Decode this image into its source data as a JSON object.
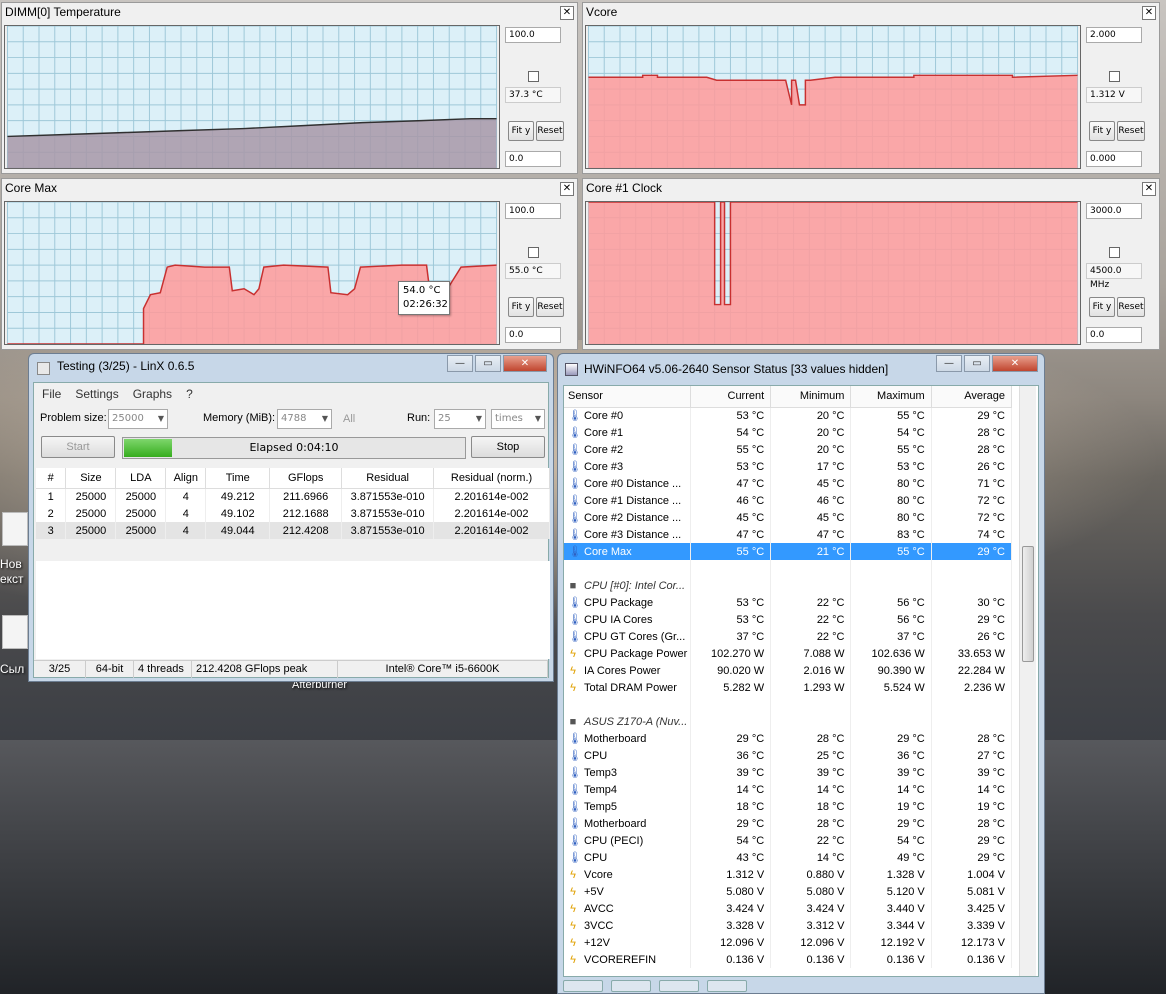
{
  "graphs": [
    {
      "title": "DIMM[0] Temperature",
      "max": "100.0",
      "current": "37.3 °C",
      "min": "0.0",
      "fit": "Fit y",
      "reset": "Reset"
    },
    {
      "title": "Vcore",
      "max": "2.000",
      "current": "1.312 V",
      "min": "0.000",
      "fit": "Fit y",
      "reset": "Reset"
    },
    {
      "title": "Core Max",
      "max": "100.0",
      "current": "55.0 °C",
      "min": "0.0",
      "fit": "Fit y",
      "reset": "Reset"
    },
    {
      "title": "Core #1 Clock",
      "max": "3000.0",
      "current": "4500.0 MHz",
      "min": "0.0",
      "fit": "Fit y",
      "reset": "Reset"
    }
  ],
  "tooltip": {
    "value": "54.0 °C",
    "time": "02:26:32"
  },
  "colors": {
    "plot_bg": "#dcf0f8",
    "grid": "#9ec8d8",
    "fill_red": "#ff9a9a",
    "line_red": "#c83030",
    "fill_purple": "#a898a8",
    "accent_blue": "#3399ff",
    "progress_green": "#42b82a"
  },
  "linx": {
    "title": "Testing (3/25) - LinX 0.6.5",
    "menu": [
      "File",
      "Settings",
      "Graphs",
      "?"
    ],
    "problem_size_label": "Problem size:",
    "problem_size": "25000",
    "memory_label": "Memory (MiB):",
    "memory": "4788",
    "all_label": "All",
    "run_label": "Run:",
    "run": "25",
    "run_unit": "times",
    "start_label": "Start",
    "stop_label": "Stop",
    "elapsed": "Elapsed 0:04:10",
    "progress": 0.14,
    "columns": [
      "#",
      "Size",
      "LDA",
      "Align",
      "Time",
      "GFlops",
      "Residual",
      "Residual (norm.)"
    ],
    "rows": [
      [
        "1",
        "25000",
        "25000",
        "4",
        "49.212",
        "211.6966",
        "3.871553e-010",
        "2.201614e-002"
      ],
      [
        "2",
        "25000",
        "25000",
        "4",
        "49.102",
        "212.1688",
        "3.871553e-010",
        "2.201614e-002"
      ],
      [
        "3",
        "25000",
        "25000",
        "4",
        "49.044",
        "212.4208",
        "3.871553e-010",
        "2.201614e-002"
      ]
    ],
    "status": [
      "3/25",
      "64-bit",
      "4 threads",
      "212.4208 GFlops peak",
      "Intel® Core™ i5-6600K"
    ]
  },
  "desktop": {
    "icon1_label": "Нов\nекст",
    "icon2_label": "Сыл",
    "afterburner": "Afterburner"
  },
  "hwinfo": {
    "title": "HWiNFO64 v5.06-2640 Sensor Status [33 values hidden]",
    "columns": [
      "Sensor",
      "Current",
      "Minimum",
      "Maximum",
      "Average"
    ],
    "rows": [
      {
        "kind": "therm",
        "cells": [
          "Core #0",
          "53 °C",
          "20 °C",
          "55 °C",
          "29 °C"
        ]
      },
      {
        "kind": "therm",
        "cells": [
          "Core #1",
          "54 °C",
          "20 °C",
          "54 °C",
          "28 °C"
        ]
      },
      {
        "kind": "therm",
        "cells": [
          "Core #2",
          "55 °C",
          "20 °C",
          "55 °C",
          "28 °C"
        ]
      },
      {
        "kind": "therm",
        "cells": [
          "Core #3",
          "53 °C",
          "17 °C",
          "53 °C",
          "26 °C"
        ]
      },
      {
        "kind": "therm",
        "cells": [
          "Core #0 Distance ...",
          "47 °C",
          "45 °C",
          "80 °C",
          "71 °C"
        ]
      },
      {
        "kind": "therm",
        "cells": [
          "Core #1 Distance ...",
          "46 °C",
          "46 °C",
          "80 °C",
          "72 °C"
        ]
      },
      {
        "kind": "therm",
        "cells": [
          "Core #2 Distance ...",
          "45 °C",
          "45 °C",
          "80 °C",
          "72 °C"
        ]
      },
      {
        "kind": "therm",
        "cells": [
          "Core #3 Distance ...",
          "47 °C",
          "47 °C",
          "83 °C",
          "74 °C"
        ]
      },
      {
        "kind": "therm",
        "sel": true,
        "cells": [
          "Core Max",
          "55 °C",
          "21 °C",
          "55 °C",
          "29 °C"
        ]
      },
      {
        "kind": "blank",
        "cells": [
          "",
          "",
          "",
          "",
          ""
        ]
      },
      {
        "kind": "group",
        "cells": [
          "CPU [#0]: Intel Cor...",
          "",
          "",
          "",
          ""
        ]
      },
      {
        "kind": "therm",
        "cells": [
          "CPU Package",
          "53 °C",
          "22 °C",
          "56 °C",
          "30 °C"
        ]
      },
      {
        "kind": "therm",
        "cells": [
          "CPU IA Cores",
          "53 °C",
          "22 °C",
          "56 °C",
          "29 °C"
        ]
      },
      {
        "kind": "therm",
        "cells": [
          "CPU GT Cores (Gr...",
          "37 °C",
          "22 °C",
          "37 °C",
          "26 °C"
        ]
      },
      {
        "kind": "power",
        "cells": [
          "CPU Package Power",
          "102.270 W",
          "7.088 W",
          "102.636 W",
          "33.653 W"
        ]
      },
      {
        "kind": "power",
        "cells": [
          "IA Cores Power",
          "90.020 W",
          "2.016 W",
          "90.390 W",
          "22.284 W"
        ]
      },
      {
        "kind": "power",
        "cells": [
          "Total DRAM Power",
          "5.282 W",
          "1.293 W",
          "5.524 W",
          "2.236 W"
        ]
      },
      {
        "kind": "blank",
        "cells": [
          "",
          "",
          "",
          "",
          ""
        ]
      },
      {
        "kind": "group",
        "cells": [
          "ASUS Z170-A (Nuv...",
          "",
          "",
          "",
          ""
        ]
      },
      {
        "kind": "therm",
        "cells": [
          "Motherboard",
          "29 °C",
          "28 °C",
          "29 °C",
          "28 °C"
        ]
      },
      {
        "kind": "therm",
        "cells": [
          "CPU",
          "36 °C",
          "25 °C",
          "36 °C",
          "27 °C"
        ]
      },
      {
        "kind": "therm",
        "cells": [
          "Temp3",
          "39 °C",
          "39 °C",
          "39 °C",
          "39 °C"
        ]
      },
      {
        "kind": "therm",
        "cells": [
          "Temp4",
          "14 °C",
          "14 °C",
          "14 °C",
          "14 °C"
        ]
      },
      {
        "kind": "therm",
        "cells": [
          "Temp5",
          "18 °C",
          "18 °C",
          "19 °C",
          "19 °C"
        ]
      },
      {
        "kind": "therm",
        "cells": [
          "Motherboard",
          "29 °C",
          "28 °C",
          "29 °C",
          "28 °C"
        ]
      },
      {
        "kind": "therm",
        "cells": [
          "CPU (PECI)",
          "54 °C",
          "22 °C",
          "54 °C",
          "29 °C"
        ]
      },
      {
        "kind": "therm",
        "cells": [
          "CPU",
          "43 °C",
          "14 °C",
          "49 °C",
          "29 °C"
        ]
      },
      {
        "kind": "volt",
        "cells": [
          "Vcore",
          "1.312 V",
          "0.880 V",
          "1.328 V",
          "1.004 V"
        ]
      },
      {
        "kind": "volt",
        "cells": [
          "+5V",
          "5.080 V",
          "5.080 V",
          "5.120 V",
          "5.081 V"
        ]
      },
      {
        "kind": "volt",
        "cells": [
          "AVCC",
          "3.424 V",
          "3.424 V",
          "3.440 V",
          "3.425 V"
        ]
      },
      {
        "kind": "volt",
        "cells": [
          "3VCC",
          "3.328 V",
          "3.312 V",
          "3.344 V",
          "3.339 V"
        ]
      },
      {
        "kind": "volt",
        "cells": [
          "+12V",
          "12.096 V",
          "12.096 V",
          "12.192 V",
          "12.173 V"
        ]
      },
      {
        "kind": "volt",
        "cells": [
          "VCOREREFIN",
          "0.136 V",
          "0.136 V",
          "0.136 V",
          "0.136 V"
        ]
      }
    ]
  }
}
